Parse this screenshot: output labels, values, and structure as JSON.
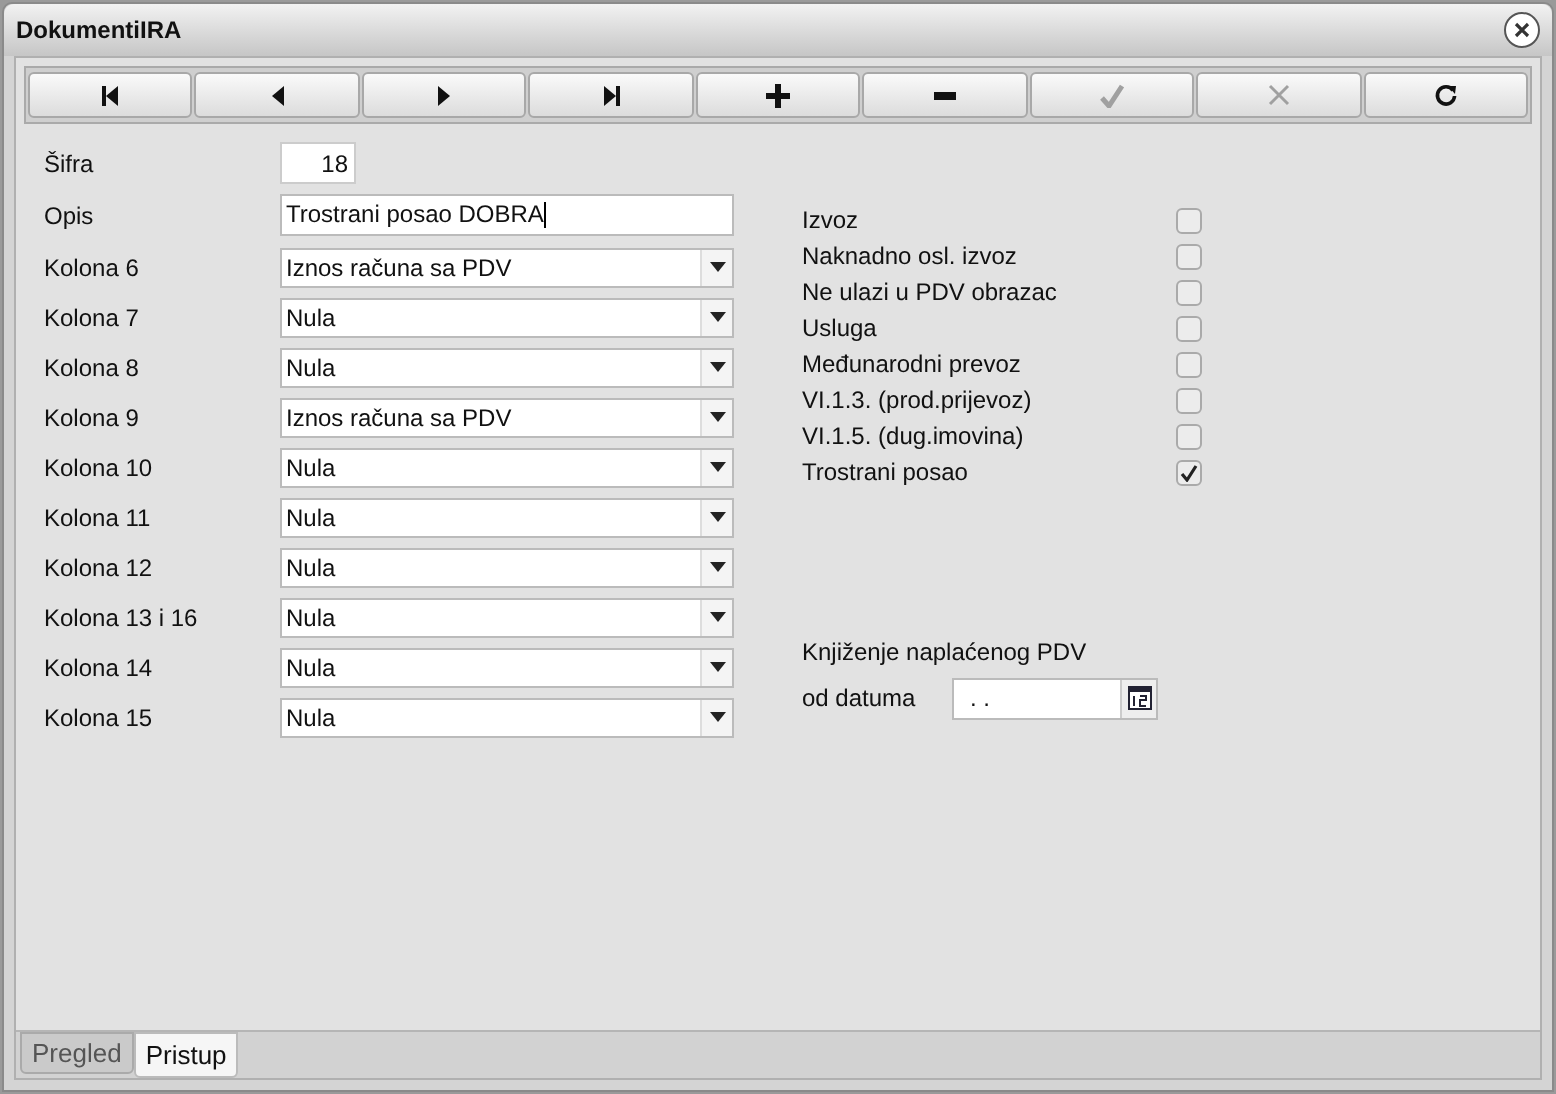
{
  "window": {
    "title": "DokumentiIRA"
  },
  "toolbar": [
    {
      "kind": "first",
      "disabled": false
    },
    {
      "kind": "prev",
      "disabled": false
    },
    {
      "kind": "next",
      "disabled": false
    },
    {
      "kind": "last",
      "disabled": false
    },
    {
      "kind": "add",
      "disabled": false
    },
    {
      "kind": "remove",
      "disabled": false
    },
    {
      "kind": "confirm",
      "disabled": true
    },
    {
      "kind": "cancel",
      "disabled": true
    },
    {
      "kind": "refresh",
      "disabled": false
    }
  ],
  "sifra": {
    "label": "Šifra",
    "value": "18"
  },
  "opis": {
    "label": "Opis",
    "value": "Trostrani posao DOBRA"
  },
  "columns": [
    {
      "label": "Kolona 6",
      "value": "Iznos računa sa PDV"
    },
    {
      "label": "Kolona 7",
      "value": "Nula"
    },
    {
      "label": "Kolona 8",
      "value": "Nula"
    },
    {
      "label": "Kolona 9",
      "value": "Iznos računa sa PDV"
    },
    {
      "label": "Kolona 10",
      "value": "Nula"
    },
    {
      "label": "Kolona 11",
      "value": "Nula"
    },
    {
      "label": "Kolona 12",
      "value": "Nula"
    },
    {
      "label": "Kolona 13 i 16",
      "value": "Nula"
    },
    {
      "label": "Kolona 14",
      "value": "Nula"
    },
    {
      "label": "Kolona 15",
      "value": "Nula"
    }
  ],
  "options": [
    {
      "label": "Izvoz",
      "checked": false
    },
    {
      "label": "Naknadno osl. izvoz",
      "checked": false
    },
    {
      "label": "Ne ulazi u PDV obrazac",
      "checked": false
    },
    {
      "label": "Usluga",
      "checked": false
    },
    {
      "label": "Međunarodni prevoz",
      "checked": false
    },
    {
      "label": "VI.1.3. (prod.prijevoz)",
      "checked": false
    },
    {
      "label": "VI.1.5. (dug.imovina)",
      "checked": false
    },
    {
      "label": "Trostrani posao",
      "checked": true
    }
  ],
  "booking": {
    "heading": "Knjiženje naplaćenog PDV",
    "date_label": "od datuma",
    "date_value": ". ."
  },
  "tabs": [
    {
      "label": "Pregled",
      "selected": false
    },
    {
      "label": "Pristup",
      "selected": true
    }
  ]
}
